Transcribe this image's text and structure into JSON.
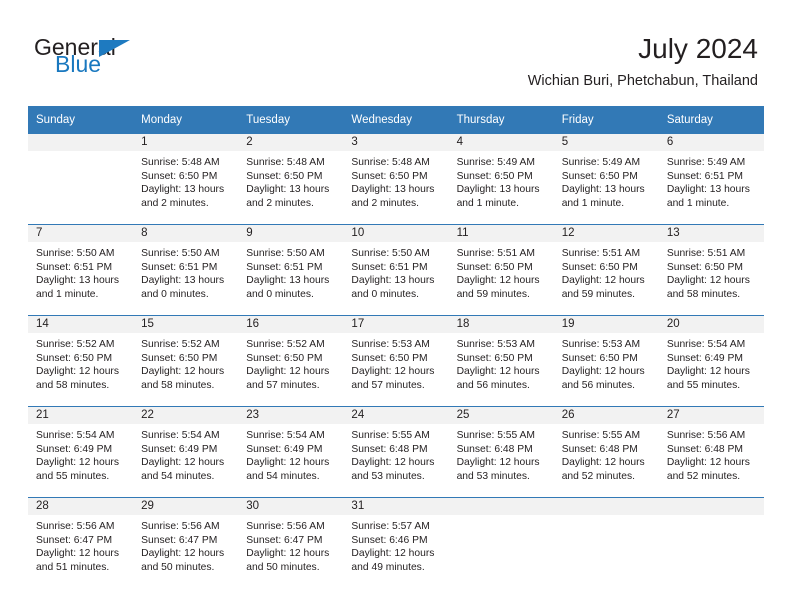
{
  "brand": {
    "name_part1": "General",
    "name_part2": "Blue",
    "flag_icon": "triangle-flag-icon",
    "blue_hex": "#1978bf"
  },
  "header": {
    "title": "July 2024",
    "subtitle": "Wichian Buri, Phetchabun, Thailand"
  },
  "theme": {
    "header_blue": "#3279b6",
    "daynum_band": "#f2f2f2",
    "text": "#231f20"
  },
  "calendar": {
    "weekday_headers": [
      "Sunday",
      "Monday",
      "Tuesday",
      "Wednesday",
      "Thursday",
      "Friday",
      "Saturday"
    ],
    "weeks": [
      [
        {
          "day": "",
          "sunrise": "",
          "sunset": "",
          "daylight_l1": "",
          "daylight_l2": ""
        },
        {
          "day": "1",
          "sunrise": "Sunrise: 5:48 AM",
          "sunset": "Sunset: 6:50 PM",
          "daylight_l1": "Daylight: 13 hours",
          "daylight_l2": "and 2 minutes."
        },
        {
          "day": "2",
          "sunrise": "Sunrise: 5:48 AM",
          "sunset": "Sunset: 6:50 PM",
          "daylight_l1": "Daylight: 13 hours",
          "daylight_l2": "and 2 minutes."
        },
        {
          "day": "3",
          "sunrise": "Sunrise: 5:48 AM",
          "sunset": "Sunset: 6:50 PM",
          "daylight_l1": "Daylight: 13 hours",
          "daylight_l2": "and 2 minutes."
        },
        {
          "day": "4",
          "sunrise": "Sunrise: 5:49 AM",
          "sunset": "Sunset: 6:50 PM",
          "daylight_l1": "Daylight: 13 hours",
          "daylight_l2": "and 1 minute."
        },
        {
          "day": "5",
          "sunrise": "Sunrise: 5:49 AM",
          "sunset": "Sunset: 6:50 PM",
          "daylight_l1": "Daylight: 13 hours",
          "daylight_l2": "and 1 minute."
        },
        {
          "day": "6",
          "sunrise": "Sunrise: 5:49 AM",
          "sunset": "Sunset: 6:51 PM",
          "daylight_l1": "Daylight: 13 hours",
          "daylight_l2": "and 1 minute."
        }
      ],
      [
        {
          "day": "7",
          "sunrise": "Sunrise: 5:50 AM",
          "sunset": "Sunset: 6:51 PM",
          "daylight_l1": "Daylight: 13 hours",
          "daylight_l2": "and 1 minute."
        },
        {
          "day": "8",
          "sunrise": "Sunrise: 5:50 AM",
          "sunset": "Sunset: 6:51 PM",
          "daylight_l1": "Daylight: 13 hours",
          "daylight_l2": "and 0 minutes."
        },
        {
          "day": "9",
          "sunrise": "Sunrise: 5:50 AM",
          "sunset": "Sunset: 6:51 PM",
          "daylight_l1": "Daylight: 13 hours",
          "daylight_l2": "and 0 minutes."
        },
        {
          "day": "10",
          "sunrise": "Sunrise: 5:50 AM",
          "sunset": "Sunset: 6:51 PM",
          "daylight_l1": "Daylight: 13 hours",
          "daylight_l2": "and 0 minutes."
        },
        {
          "day": "11",
          "sunrise": "Sunrise: 5:51 AM",
          "sunset": "Sunset: 6:50 PM",
          "daylight_l1": "Daylight: 12 hours",
          "daylight_l2": "and 59 minutes."
        },
        {
          "day": "12",
          "sunrise": "Sunrise: 5:51 AM",
          "sunset": "Sunset: 6:50 PM",
          "daylight_l1": "Daylight: 12 hours",
          "daylight_l2": "and 59 minutes."
        },
        {
          "day": "13",
          "sunrise": "Sunrise: 5:51 AM",
          "sunset": "Sunset: 6:50 PM",
          "daylight_l1": "Daylight: 12 hours",
          "daylight_l2": "and 58 minutes."
        }
      ],
      [
        {
          "day": "14",
          "sunrise": "Sunrise: 5:52 AM",
          "sunset": "Sunset: 6:50 PM",
          "daylight_l1": "Daylight: 12 hours",
          "daylight_l2": "and 58 minutes."
        },
        {
          "day": "15",
          "sunrise": "Sunrise: 5:52 AM",
          "sunset": "Sunset: 6:50 PM",
          "daylight_l1": "Daylight: 12 hours",
          "daylight_l2": "and 58 minutes."
        },
        {
          "day": "16",
          "sunrise": "Sunrise: 5:52 AM",
          "sunset": "Sunset: 6:50 PM",
          "daylight_l1": "Daylight: 12 hours",
          "daylight_l2": "and 57 minutes."
        },
        {
          "day": "17",
          "sunrise": "Sunrise: 5:53 AM",
          "sunset": "Sunset: 6:50 PM",
          "daylight_l1": "Daylight: 12 hours",
          "daylight_l2": "and 57 minutes."
        },
        {
          "day": "18",
          "sunrise": "Sunrise: 5:53 AM",
          "sunset": "Sunset: 6:50 PM",
          "daylight_l1": "Daylight: 12 hours",
          "daylight_l2": "and 56 minutes."
        },
        {
          "day": "19",
          "sunrise": "Sunrise: 5:53 AM",
          "sunset": "Sunset: 6:50 PM",
          "daylight_l1": "Daylight: 12 hours",
          "daylight_l2": "and 56 minutes."
        },
        {
          "day": "20",
          "sunrise": "Sunrise: 5:54 AM",
          "sunset": "Sunset: 6:49 PM",
          "daylight_l1": "Daylight: 12 hours",
          "daylight_l2": "and 55 minutes."
        }
      ],
      [
        {
          "day": "21",
          "sunrise": "Sunrise: 5:54 AM",
          "sunset": "Sunset: 6:49 PM",
          "daylight_l1": "Daylight: 12 hours",
          "daylight_l2": "and 55 minutes."
        },
        {
          "day": "22",
          "sunrise": "Sunrise: 5:54 AM",
          "sunset": "Sunset: 6:49 PM",
          "daylight_l1": "Daylight: 12 hours",
          "daylight_l2": "and 54 minutes."
        },
        {
          "day": "23",
          "sunrise": "Sunrise: 5:54 AM",
          "sunset": "Sunset: 6:49 PM",
          "daylight_l1": "Daylight: 12 hours",
          "daylight_l2": "and 54 minutes."
        },
        {
          "day": "24",
          "sunrise": "Sunrise: 5:55 AM",
          "sunset": "Sunset: 6:48 PM",
          "daylight_l1": "Daylight: 12 hours",
          "daylight_l2": "and 53 minutes."
        },
        {
          "day": "25",
          "sunrise": "Sunrise: 5:55 AM",
          "sunset": "Sunset: 6:48 PM",
          "daylight_l1": "Daylight: 12 hours",
          "daylight_l2": "and 53 minutes."
        },
        {
          "day": "26",
          "sunrise": "Sunrise: 5:55 AM",
          "sunset": "Sunset: 6:48 PM",
          "daylight_l1": "Daylight: 12 hours",
          "daylight_l2": "and 52 minutes."
        },
        {
          "day": "27",
          "sunrise": "Sunrise: 5:56 AM",
          "sunset": "Sunset: 6:48 PM",
          "daylight_l1": "Daylight: 12 hours",
          "daylight_l2": "and 52 minutes."
        }
      ],
      [
        {
          "day": "28",
          "sunrise": "Sunrise: 5:56 AM",
          "sunset": "Sunset: 6:47 PM",
          "daylight_l1": "Daylight: 12 hours",
          "daylight_l2": "and 51 minutes."
        },
        {
          "day": "29",
          "sunrise": "Sunrise: 5:56 AM",
          "sunset": "Sunset: 6:47 PM",
          "daylight_l1": "Daylight: 12 hours",
          "daylight_l2": "and 50 minutes."
        },
        {
          "day": "30",
          "sunrise": "Sunrise: 5:56 AM",
          "sunset": "Sunset: 6:47 PM",
          "daylight_l1": "Daylight: 12 hours",
          "daylight_l2": "and 50 minutes."
        },
        {
          "day": "31",
          "sunrise": "Sunrise: 5:57 AM",
          "sunset": "Sunset: 6:46 PM",
          "daylight_l1": "Daylight: 12 hours",
          "daylight_l2": "and 49 minutes."
        },
        {
          "day": "",
          "sunrise": "",
          "sunset": "",
          "daylight_l1": "",
          "daylight_l2": ""
        },
        {
          "day": "",
          "sunrise": "",
          "sunset": "",
          "daylight_l1": "",
          "daylight_l2": ""
        },
        {
          "day": "",
          "sunrise": "",
          "sunset": "",
          "daylight_l1": "",
          "daylight_l2": ""
        }
      ]
    ]
  }
}
